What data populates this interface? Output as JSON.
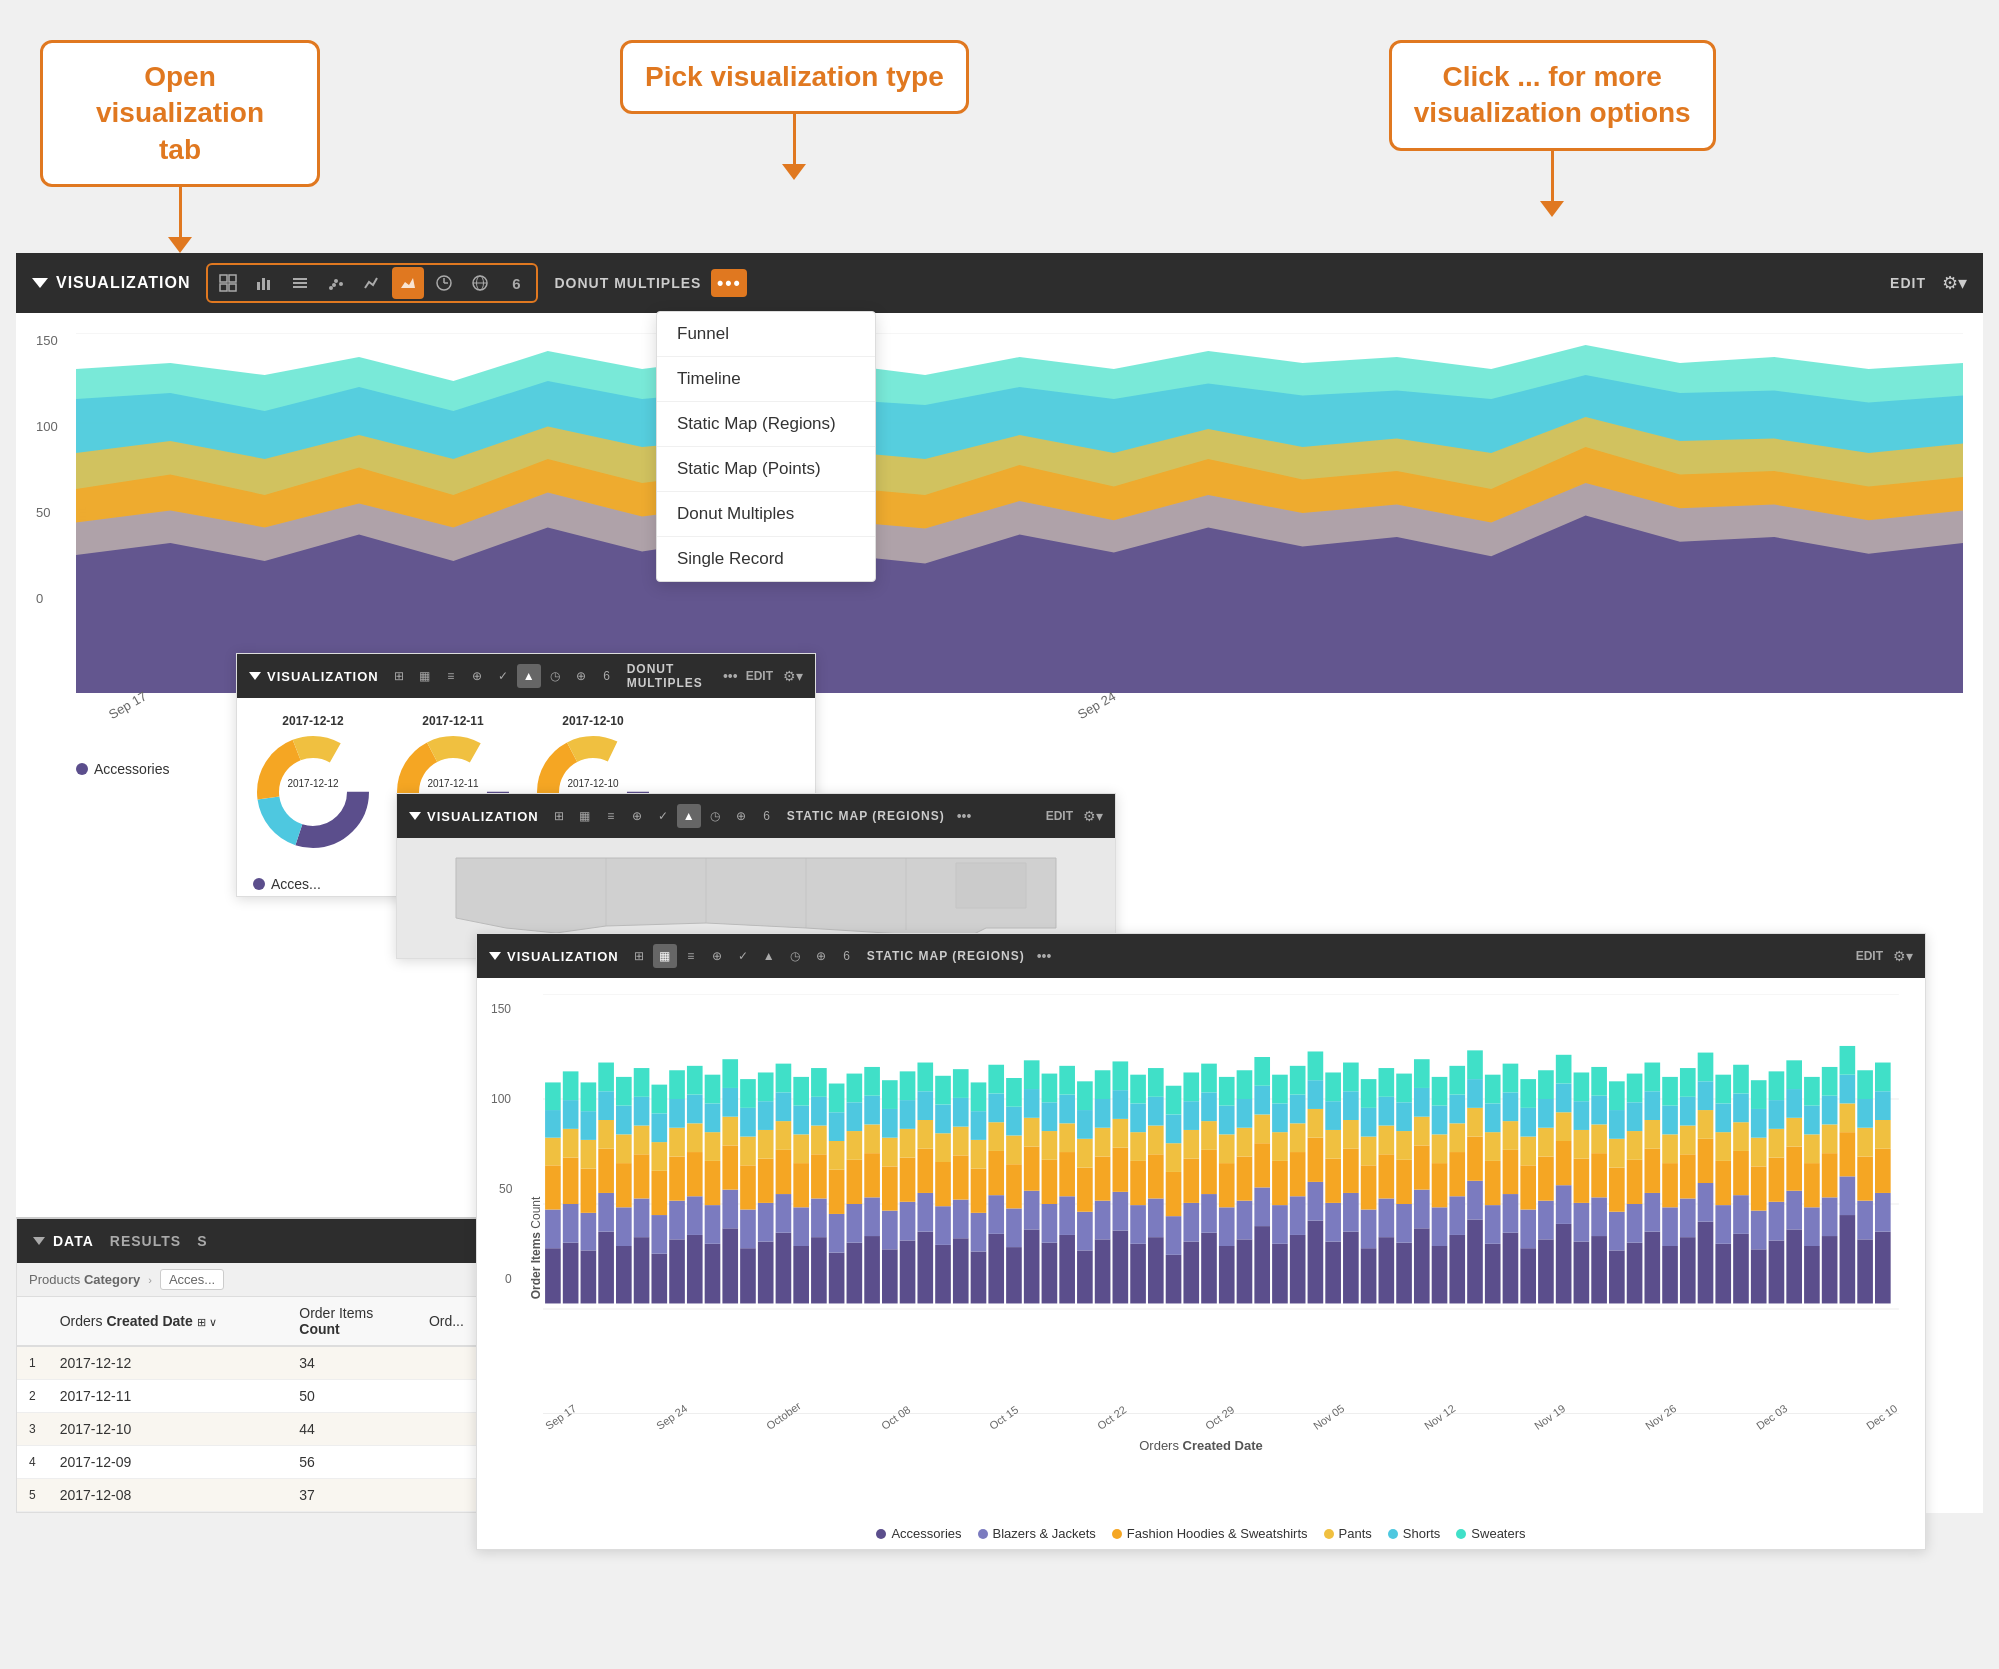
{
  "callouts": {
    "box1": "Open visualization\ntab",
    "box2": "Pick visualization type",
    "box3": "Click ... for more\nvisualization options"
  },
  "vizBar": {
    "title": "VISUALIZATION",
    "icons": [
      {
        "name": "table",
        "symbol": "⊞",
        "active": false
      },
      {
        "name": "bar",
        "symbol": "▦",
        "active": false
      },
      {
        "name": "list",
        "symbol": "≡",
        "active": false
      },
      {
        "name": "scatter",
        "symbol": "⊕",
        "active": false
      },
      {
        "name": "line",
        "symbol": "✓",
        "active": false
      },
      {
        "name": "area",
        "symbol": "▲",
        "active": true
      },
      {
        "name": "clock",
        "symbol": "◷",
        "active": false
      },
      {
        "name": "map",
        "symbol": "⊕",
        "active": false
      },
      {
        "name": "num",
        "symbol": "6",
        "active": false
      }
    ],
    "typeLabel": "DONUT MULTIPLES",
    "dotsLabel": "•••",
    "editLabel": "EDIT",
    "gearLabel": "⚙"
  },
  "dropdown": {
    "items": [
      "Funnel",
      "Timeline",
      "Static Map (Regions)",
      "Static Map (Points)",
      "Donut Multiples",
      "Single Record"
    ]
  },
  "areaChart": {
    "yAxisLabel": "Order Items Count",
    "xLabels": [
      "Sep 17",
      "Sep 24"
    ],
    "yMax": 150,
    "yMid": 100,
    "yLow": 50,
    "y0": 0
  },
  "legend": {
    "items": [
      {
        "color": "#5b4e8c",
        "label": "Accessories"
      },
      {
        "color": "#a0a0c8",
        "label": "Blazers & Jackets"
      },
      {
        "color": "#f5a623",
        "label": "Fashion Hoodies & Sweatshirts"
      },
      {
        "color": "#f0c040",
        "label": "Pants"
      },
      {
        "color": "#4ec8e0",
        "label": "Shorts"
      },
      {
        "color": "#40e0c8",
        "label": "Sweaters"
      }
    ]
  },
  "dataPanel": {
    "tabs": [
      "DATA",
      "RESULTS",
      "S"
    ],
    "filterLabel": "Products Category",
    "filterValue": "Acces...",
    "columns": {
      "col1": "Orders Created Date",
      "col2": "Order Items Count",
      "col3": "Ord..."
    },
    "rows": [
      {
        "num": 1,
        "date": "2017-12-12",
        "count": "34"
      },
      {
        "num": 2,
        "date": "2017-12-11",
        "count": "50"
      },
      {
        "num": 3,
        "date": "2017-12-10",
        "count": "44"
      },
      {
        "num": 4,
        "date": "2017-12-09",
        "count": "56"
      },
      {
        "num": 5,
        "date": "2017-12-08",
        "count": "37"
      }
    ]
  },
  "miniBar1": {
    "title": "VISUALIZATION",
    "typeLabel": "DONUT MULTIPLES",
    "editLabel": "EDIT"
  },
  "miniBar2": {
    "title": "VISUALIZATION",
    "typeLabel": "STATIC MAP (REGIONS)",
    "editLabel": "EDIT"
  },
  "miniBar3": {
    "title": "VISUALIZATION",
    "typeLabel": "STATIC MAP (REGIONS)",
    "editLabel": "EDIT"
  },
  "donutDates": [
    "2017-12-12",
    "2017-12-11",
    "2017-12-10"
  ],
  "barChart": {
    "yAxisLabel": "Order Items Count",
    "xAxisLabel": "Orders Created Date",
    "yMax": 150,
    "yMid": 100,
    "yLow": 50,
    "y0": 0,
    "xLabels": [
      "Sep 17",
      "Sep 24",
      "October",
      "Oct 08",
      "Oct 15",
      "Oct 22",
      "Oct 29",
      "Nov 05",
      "Nov 12",
      "Nov 19",
      "Nov 26",
      "Dec 03",
      "Dec 10"
    ]
  },
  "bottomLegend": {
    "items": [
      {
        "color": "#5b4e8c",
        "label": "Accessories"
      },
      {
        "color": "#7b7bbf",
        "label": "Blazers & Jackets"
      },
      {
        "color": "#f5a623",
        "label": "Fashion Hoodies & Sweatshirts"
      },
      {
        "color": "#f0c040",
        "label": "Pants"
      },
      {
        "color": "#4ec8e0",
        "label": "Shorts"
      },
      {
        "color": "#40e0c8",
        "label": "Sweaters"
      }
    ]
  }
}
